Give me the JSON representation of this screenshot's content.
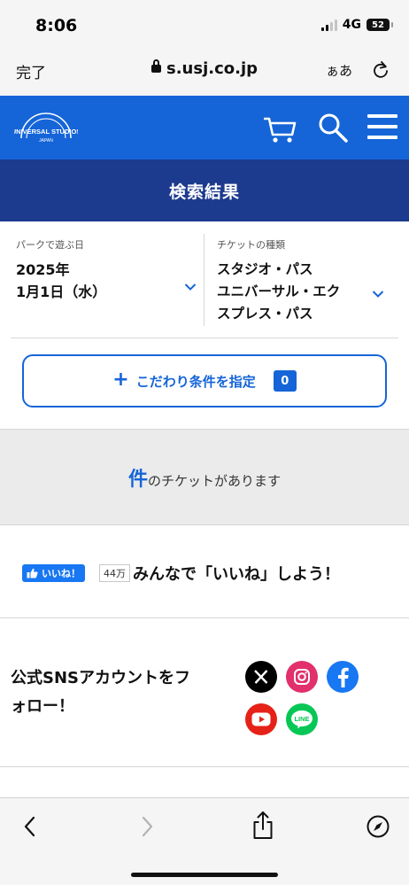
{
  "status_bar": {
    "time": "8:06",
    "network": "4G",
    "battery": "52"
  },
  "browser": {
    "done_label": "完了",
    "url": "s.usj.co.jp",
    "text_size_label": "ぁあ"
  },
  "header": {
    "logo_text_top": "UNIVERSAL STUDIOS",
    "logo_text_bottom": "JAPAN",
    "brand_color": "#1565d8",
    "icons": [
      "cart-icon",
      "search-icon",
      "menu-icon"
    ]
  },
  "page": {
    "title": "検索結果",
    "title_bg": "#1c3a8e"
  },
  "filters": {
    "date": {
      "label": "パークで遊ぶ日",
      "value_line1": "2025年",
      "value_line2": "1月1日（水）"
    },
    "ticket_type": {
      "label": "チケットの種類",
      "value_line1": "スタジオ・パス",
      "value_line2": "ユニバーサル・エク",
      "value_line3": "スプレス・パス"
    },
    "condition_button": {
      "plus": "+",
      "label": "こだわり条件を指定",
      "count": "0"
    }
  },
  "results": {
    "count_label": "件",
    "message": "のチケットがあります"
  },
  "like": {
    "button_label": "いいね！",
    "count": "44万",
    "headline": "みんなで「いいね」しよう！"
  },
  "sns": {
    "title_line1": "公式SNSアカウントをフ",
    "title_line2": "ォロー！",
    "icons": [
      "x-icon",
      "instagram-icon",
      "facebook-icon",
      "youtube-icon",
      "line-icon"
    ],
    "line_badge": "LINE"
  },
  "toolbar": {
    "icons": [
      "back-icon",
      "forward-icon",
      "share-icon",
      "compass-icon"
    ]
  }
}
